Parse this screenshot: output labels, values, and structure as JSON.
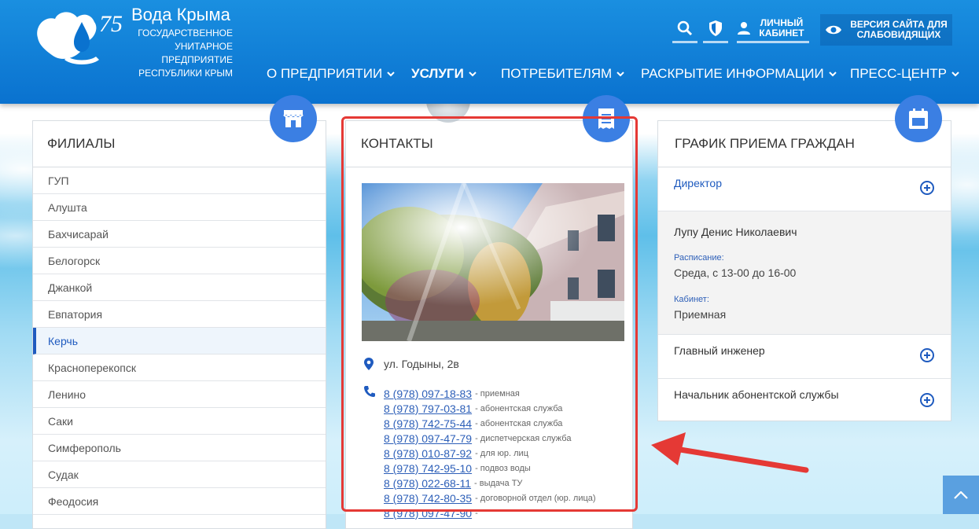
{
  "brand": {
    "title": "Вода Крыма",
    "subtitle": "ГОСУДАРСТВЕННОЕ УНИТАРНОЕ ПРЕДПРИЯТИЕ РЕСПУБЛИКИ КРЫМ",
    "anniversary": "75"
  },
  "header": {
    "cabinet_label": "ЛИЧНЫЙ КАБИНЕТ",
    "vision_label": "ВЕРСИЯ САЙТА ДЛЯ СЛАБОВИДЯЩИХ",
    "icons": [
      "search-icon",
      "shield-icon",
      "user-icon",
      "eye-icon"
    ]
  },
  "nav": [
    {
      "label": "О ПРЕДПРИЯТИИ"
    },
    {
      "label": "УСЛУГИ"
    },
    {
      "label": "ПОТРЕБИТЕЛЯМ"
    },
    {
      "label": "РАСКРЫТИЕ ИНФОРМАЦИИ"
    },
    {
      "label": "ПРЕСС-ЦЕНТР"
    }
  ],
  "branches": {
    "title": "ФИЛИАЛЫ",
    "items": [
      "ГУП",
      "Алушта",
      "Бахчисарай",
      "Белогорск",
      "Джанкой",
      "Евпатория",
      "Керчь",
      "Красноперекопск",
      "Ленино",
      "Саки",
      "Симферополь",
      "Судак",
      "Феодосия"
    ],
    "active": "Керчь"
  },
  "contacts": {
    "title": "КОНТАКТЫ",
    "address": "ул. Годыны, 2в",
    "phones": [
      {
        "number": "8 (978) 097-18-83",
        "note": "- приемная"
      },
      {
        "number": "8 (978) 797-03-81",
        "note": "- абонентская служба"
      },
      {
        "number": "8 (978) 742-75-44",
        "note": "- абонентская служба"
      },
      {
        "number": "8 (978) 097-47-79",
        "note": "- диспетчерская служба"
      },
      {
        "number": "8 (978) 010-87-92",
        "note": "- для юр. лиц"
      },
      {
        "number": "8 (978) 742-95-10",
        "note": "- подвоз воды"
      },
      {
        "number": "8 (978) 022-68-11",
        "note": "- выдача ТУ"
      },
      {
        "number": "8 (978) 742-80-35",
        "note": "- договорной отдел (юр. лица)"
      },
      {
        "number": "8 (978) 097-47-90",
        "note": "- "
      }
    ]
  },
  "schedule": {
    "title": "ГРАФИК ПРИЕМА ГРАЖДАН",
    "director": {
      "label": "Директор",
      "name": "Лупу Денис Николаевич",
      "schedule_label": "Расписание:",
      "schedule_value": "Среда, с 13-00 до 16-00",
      "cabinet_label": "Кабинет:",
      "cabinet_value": "Приемная"
    },
    "items": [
      {
        "label": "Главный инженер"
      },
      {
        "label": "Начальник абонентской службы"
      }
    ]
  },
  "colors": {
    "header": "#0a72cf",
    "accent": "#1f5bbf",
    "circle": "#3b7fe3",
    "highlight": "#e53935"
  }
}
